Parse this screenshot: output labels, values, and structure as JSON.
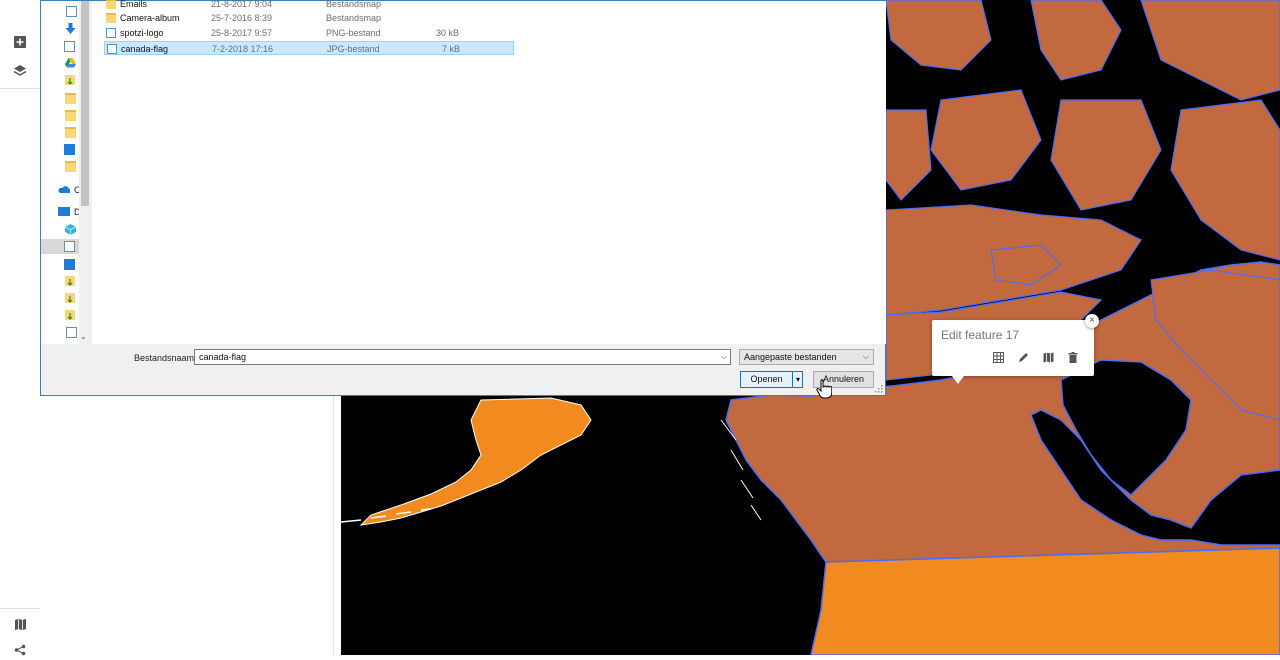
{
  "dialog": {
    "files": [
      {
        "name": "Emails",
        "date": "21-8-2017 9:04",
        "type": "Bestandsmap",
        "size": "",
        "icon": "folder-icon",
        "selected": false
      },
      {
        "name": "Camera-album",
        "date": "25-7-2016 8:39",
        "type": "Bestandsmap",
        "size": "",
        "icon": "folder-icon",
        "selected": false
      },
      {
        "name": "spotzi-logo",
        "date": "25-8-2017 9:57",
        "type": "PNG-bestand",
        "size": "30 kB",
        "icon": "image-file-icon",
        "selected": false
      },
      {
        "name": "canada-flag",
        "date": "7-2-2018 17:16",
        "type": "JPG-bestand",
        "size": "7 kB",
        "icon": "image-file-icon",
        "selected": true
      }
    ],
    "nav": {
      "onedrive_label": "C",
      "pc_label": "D"
    },
    "filename_label": "Bestandsnaam:",
    "filename_value": "canada-flag",
    "filter_value": "Aangepaste bestanden",
    "open_label": "Openen",
    "cancel_label": "Annuleren"
  },
  "popup": {
    "title": "Edit feature 17",
    "close_label": "×",
    "tools": [
      "table-icon",
      "edit-pencil-icon",
      "map-icon",
      "trash-icon"
    ]
  },
  "map": {
    "land_color": "#c2693f",
    "usa_color": "#f28b1f",
    "alaska_color": "#f28b1f",
    "outline_color": "#4d6cf5",
    "water_color": "#000000"
  },
  "sidebar": {
    "icons": [
      "add-icon",
      "layers-icon",
      "map-icon",
      "share-icon"
    ]
  }
}
